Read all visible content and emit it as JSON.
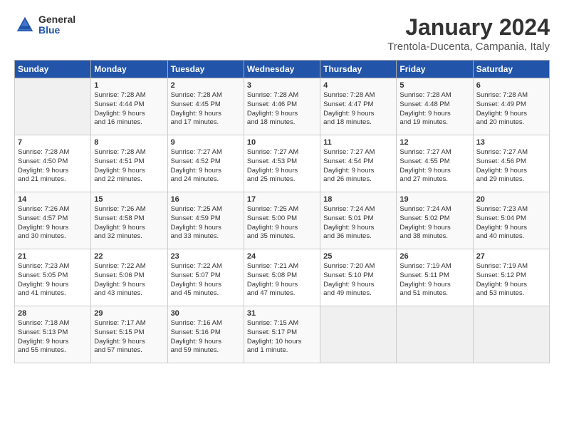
{
  "header": {
    "logo_general": "General",
    "logo_blue": "Blue",
    "month_title": "January 2024",
    "location": "Trentola-Ducenta, Campania, Italy"
  },
  "days_of_week": [
    "Sunday",
    "Monday",
    "Tuesday",
    "Wednesday",
    "Thursday",
    "Friday",
    "Saturday"
  ],
  "weeks": [
    [
      {
        "day": "",
        "content": ""
      },
      {
        "day": "1",
        "content": "Sunrise: 7:28 AM\nSunset: 4:44 PM\nDaylight: 9 hours\nand 16 minutes."
      },
      {
        "day": "2",
        "content": "Sunrise: 7:28 AM\nSunset: 4:45 PM\nDaylight: 9 hours\nand 17 minutes."
      },
      {
        "day": "3",
        "content": "Sunrise: 7:28 AM\nSunset: 4:46 PM\nDaylight: 9 hours\nand 18 minutes."
      },
      {
        "day": "4",
        "content": "Sunrise: 7:28 AM\nSunset: 4:47 PM\nDaylight: 9 hours\nand 18 minutes."
      },
      {
        "day": "5",
        "content": "Sunrise: 7:28 AM\nSunset: 4:48 PM\nDaylight: 9 hours\nand 19 minutes."
      },
      {
        "day": "6",
        "content": "Sunrise: 7:28 AM\nSunset: 4:49 PM\nDaylight: 9 hours\nand 20 minutes."
      }
    ],
    [
      {
        "day": "7",
        "content": "Sunrise: 7:28 AM\nSunset: 4:50 PM\nDaylight: 9 hours\nand 21 minutes."
      },
      {
        "day": "8",
        "content": "Sunrise: 7:28 AM\nSunset: 4:51 PM\nDaylight: 9 hours\nand 22 minutes."
      },
      {
        "day": "9",
        "content": "Sunrise: 7:27 AM\nSunset: 4:52 PM\nDaylight: 9 hours\nand 24 minutes."
      },
      {
        "day": "10",
        "content": "Sunrise: 7:27 AM\nSunset: 4:53 PM\nDaylight: 9 hours\nand 25 minutes."
      },
      {
        "day": "11",
        "content": "Sunrise: 7:27 AM\nSunset: 4:54 PM\nDaylight: 9 hours\nand 26 minutes."
      },
      {
        "day": "12",
        "content": "Sunrise: 7:27 AM\nSunset: 4:55 PM\nDaylight: 9 hours\nand 27 minutes."
      },
      {
        "day": "13",
        "content": "Sunrise: 7:27 AM\nSunset: 4:56 PM\nDaylight: 9 hours\nand 29 minutes."
      }
    ],
    [
      {
        "day": "14",
        "content": "Sunrise: 7:26 AM\nSunset: 4:57 PM\nDaylight: 9 hours\nand 30 minutes."
      },
      {
        "day": "15",
        "content": "Sunrise: 7:26 AM\nSunset: 4:58 PM\nDaylight: 9 hours\nand 32 minutes."
      },
      {
        "day": "16",
        "content": "Sunrise: 7:25 AM\nSunset: 4:59 PM\nDaylight: 9 hours\nand 33 minutes."
      },
      {
        "day": "17",
        "content": "Sunrise: 7:25 AM\nSunset: 5:00 PM\nDaylight: 9 hours\nand 35 minutes."
      },
      {
        "day": "18",
        "content": "Sunrise: 7:24 AM\nSunset: 5:01 PM\nDaylight: 9 hours\nand 36 minutes."
      },
      {
        "day": "19",
        "content": "Sunrise: 7:24 AM\nSunset: 5:02 PM\nDaylight: 9 hours\nand 38 minutes."
      },
      {
        "day": "20",
        "content": "Sunrise: 7:23 AM\nSunset: 5:04 PM\nDaylight: 9 hours\nand 40 minutes."
      }
    ],
    [
      {
        "day": "21",
        "content": "Sunrise: 7:23 AM\nSunset: 5:05 PM\nDaylight: 9 hours\nand 41 minutes."
      },
      {
        "day": "22",
        "content": "Sunrise: 7:22 AM\nSunset: 5:06 PM\nDaylight: 9 hours\nand 43 minutes."
      },
      {
        "day": "23",
        "content": "Sunrise: 7:22 AM\nSunset: 5:07 PM\nDaylight: 9 hours\nand 45 minutes."
      },
      {
        "day": "24",
        "content": "Sunrise: 7:21 AM\nSunset: 5:08 PM\nDaylight: 9 hours\nand 47 minutes."
      },
      {
        "day": "25",
        "content": "Sunrise: 7:20 AM\nSunset: 5:10 PM\nDaylight: 9 hours\nand 49 minutes."
      },
      {
        "day": "26",
        "content": "Sunrise: 7:19 AM\nSunset: 5:11 PM\nDaylight: 9 hours\nand 51 minutes."
      },
      {
        "day": "27",
        "content": "Sunrise: 7:19 AM\nSunset: 5:12 PM\nDaylight: 9 hours\nand 53 minutes."
      }
    ],
    [
      {
        "day": "28",
        "content": "Sunrise: 7:18 AM\nSunset: 5:13 PM\nDaylight: 9 hours\nand 55 minutes."
      },
      {
        "day": "29",
        "content": "Sunrise: 7:17 AM\nSunset: 5:15 PM\nDaylight: 9 hours\nand 57 minutes."
      },
      {
        "day": "30",
        "content": "Sunrise: 7:16 AM\nSunset: 5:16 PM\nDaylight: 9 hours\nand 59 minutes."
      },
      {
        "day": "31",
        "content": "Sunrise: 7:15 AM\nSunset: 5:17 PM\nDaylight: 10 hours\nand 1 minute."
      },
      {
        "day": "",
        "content": ""
      },
      {
        "day": "",
        "content": ""
      },
      {
        "day": "",
        "content": ""
      }
    ]
  ]
}
